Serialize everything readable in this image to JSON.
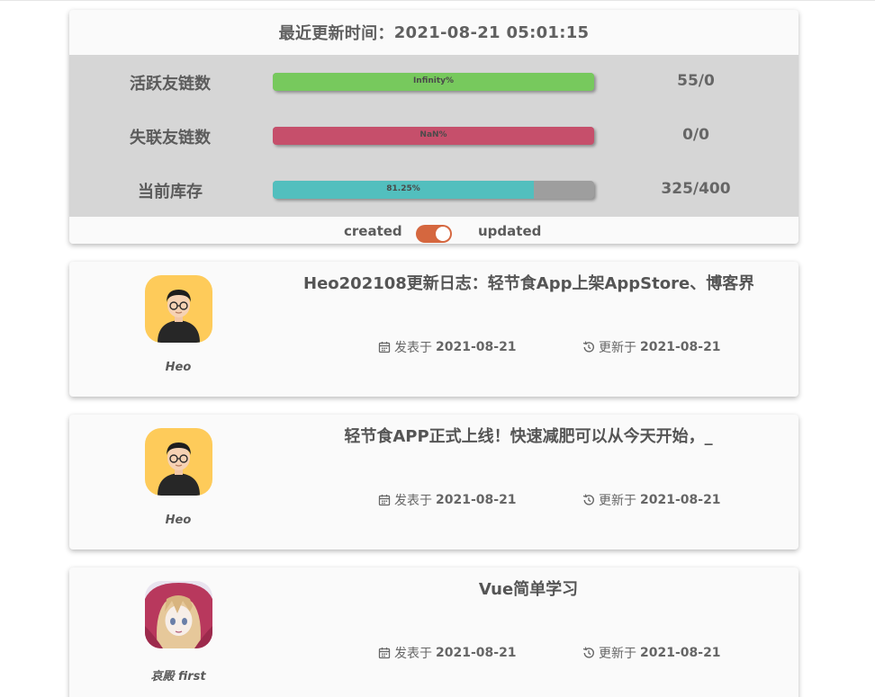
{
  "stats": {
    "header_label": "最近更新时间",
    "header_sep": "：",
    "header_time": "2021-08-21 05:01:15",
    "rows": [
      {
        "label": "活跃友链数",
        "bar_text": "Infinity%",
        "fill": 1.0,
        "fill_color": "#77c95d",
        "value": "55/0"
      },
      {
        "label": "失联友链数",
        "bar_text": "NaN%",
        "fill": 1.0,
        "fill_color": "#c64f6b",
        "value": "0/0"
      },
      {
        "label": "当前库存",
        "bar_text": "81.25%",
        "fill": 0.8125,
        "fill_color": "#52bfbe",
        "value": "325/400"
      }
    ],
    "toggle_left": "created",
    "toggle_right": "updated",
    "toggle_color": "#d5673f"
  },
  "posts": [
    {
      "title": "Heo202108更新日志：轻节食App上架AppStore、博客界_",
      "author": "Heo",
      "published_prefix": "发表于",
      "published": "2021-08-21",
      "updated_prefix": "更新于",
      "updated": "2021-08-21",
      "avatar_icon": "heo-avatar"
    },
    {
      "title": "轻节食APP正式上线！快速减肥可以从今天开始，_",
      "author": "Heo",
      "published_prefix": "发表于",
      "published": "2021-08-21",
      "updated_prefix": "更新于",
      "updated": "2021-08-21",
      "avatar_icon": "heo-avatar"
    },
    {
      "title": "Vue简单学习",
      "author": "哀殿 first",
      "published_prefix": "发表于",
      "published": "2021-08-21",
      "updated_prefix": "更新于",
      "updated": "2021-08-21",
      "avatar_icon": "anime-avatar"
    }
  ]
}
